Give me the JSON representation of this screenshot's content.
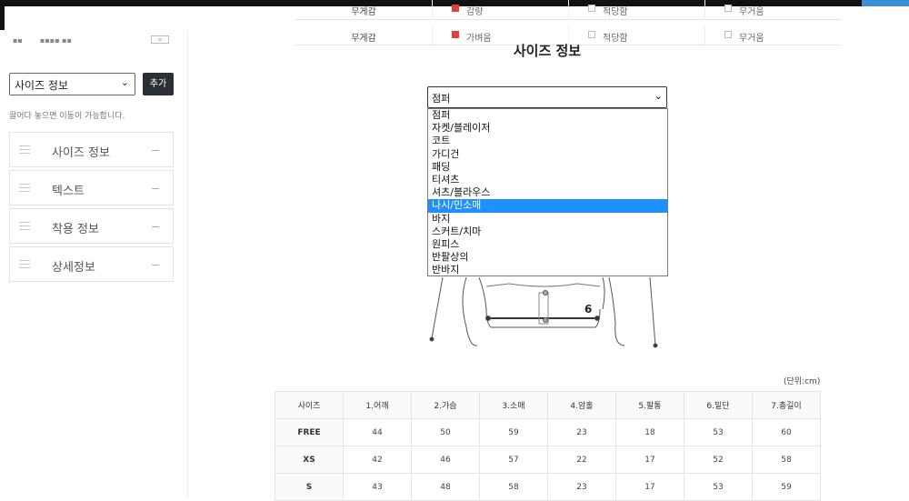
{
  "bg_table": {
    "rows": [
      {
        "label": "무게감",
        "options": [
          "감량",
          "적당함",
          "무거움"
        ]
      },
      {
        "label": "무게감",
        "options": [
          "가벼움",
          "적당함",
          "무거움"
        ]
      }
    ],
    "checked_color": "#e43d3d"
  },
  "left_panel": {
    "logo_badge": "",
    "block_type_select": "사이즈 정보",
    "add_button": "추가",
    "hint": "끌어다 놓으면 이동이 가능합니다.",
    "blocks": [
      {
        "label": "사이즈 정보"
      },
      {
        "label": "텍스트"
      },
      {
        "label": "착용 정보"
      },
      {
        "label": "상세정보"
      }
    ]
  },
  "main": {
    "title": "사이즈 정보",
    "category_select": {
      "value": "점퍼",
      "options": [
        "점퍼",
        "자켓/블레이저",
        "코트",
        "가디건",
        "패딩",
        "티셔츠",
        "셔츠/블라우스",
        "나시/민소매",
        "바지",
        "스커트/치마",
        "원피스",
        "반팔상의",
        "반바지"
      ],
      "highlighted_index": 7
    },
    "diagram_label": "6",
    "unit": "(단위:cm)",
    "size_table": {
      "headers": [
        "사이즈",
        "1.어깨",
        "2.가슴",
        "3.소매",
        "4.암홀",
        "5.팔통",
        "6.밑단",
        "7.총길이"
      ],
      "rows": [
        [
          "FREE",
          "44",
          "50",
          "59",
          "23",
          "18",
          "53",
          "60"
        ],
        [
          "XS",
          "42",
          "46",
          "57",
          "22",
          "17",
          "52",
          "58"
        ],
        [
          "S",
          "43",
          "48",
          "58",
          "23",
          "17",
          "53",
          "59"
        ]
      ]
    }
  },
  "colors": {
    "accent": "#3b8fd6",
    "highlight": "#1e90ff",
    "button_dark": "#2b2f36"
  }
}
